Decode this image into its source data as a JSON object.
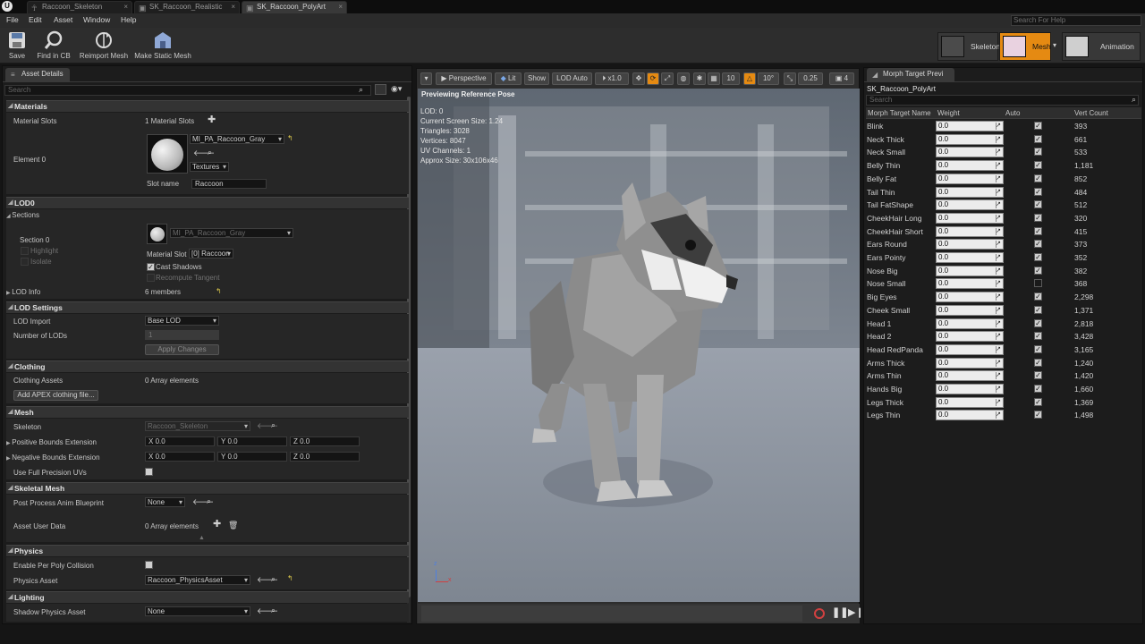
{
  "tabs": [
    "Raccoon_Skeleton",
    "SK_Raccoon_Realistic",
    "SK_Raccoon_PolyArt"
  ],
  "menu": [
    "File",
    "Edit",
    "Asset",
    "Window",
    "Help"
  ],
  "help_search": "Search For Help",
  "toolbar": {
    "save": "Save",
    "find_in_cb": "Find in CB",
    "reimport": "Reimport Mesh",
    "make_static": "Make Static Mesh"
  },
  "modes": {
    "skeleton": "Skeleton",
    "mesh": "Mesh",
    "animation": "Animation"
  },
  "details": {
    "tab": "Asset Details",
    "search_placeholder": "Search",
    "materials": {
      "header": "Materials",
      "material_slots_label": "Material Slots",
      "material_slots_value": "1 Material Slots",
      "element_label": "Element 0",
      "material_name": "MI_PA_Raccoon_Gray",
      "textures": "Textures",
      "slot_name_label": "Slot name",
      "slot_name_value": "Raccoon"
    },
    "lod0": {
      "header": "LOD0",
      "sections_label": "Sections",
      "section_label": "Section 0",
      "highlight": "Highlight",
      "isolate": "Isolate",
      "material_name": "MI_PA_Raccoon_Gray",
      "material_slot_label": "Material Slot",
      "material_slot_value": "[0] Raccoon",
      "cast_shadows": "Cast Shadows",
      "recompute_tangent": "Recompute Tangent",
      "lod_info_label": "LOD Info",
      "lod_info_value": "6 members"
    },
    "lod_settings": {
      "header": "LOD Settings",
      "lod_import_label": "LOD Import",
      "lod_import_value": "Base LOD",
      "num_lods_label": "Number of LODs",
      "num_lods_value": "1",
      "apply_changes": "Apply Changes"
    },
    "clothing": {
      "header": "Clothing",
      "assets_label": "Clothing Assets",
      "assets_value": "0 Array elements",
      "add_button": "Add APEX clothing file..."
    },
    "mesh": {
      "header": "Mesh",
      "skeleton_label": "Skeleton",
      "skeleton_value": "Raccoon_Skeleton",
      "pos_bounds_label": "Positive Bounds Extension",
      "neg_bounds_label": "Negative Bounds Extension",
      "axis_x": "X",
      "axis_y": "Y",
      "axis_z": "Z",
      "bounds_value": "0.0",
      "full_precision_label": "Use Full Precision UVs"
    },
    "skeletal_mesh": {
      "header": "Skeletal Mesh",
      "post_process_label": "Post Process Anim Blueprint",
      "post_process_value": "None",
      "asset_user_data_label": "Asset User Data",
      "asset_user_data_value": "0 Array elements"
    },
    "physics": {
      "header": "Physics",
      "per_poly_label": "Enable Per Poly Collision",
      "physics_asset_label": "Physics Asset",
      "physics_asset_value": "Raccoon_PhysicsAsset"
    },
    "lighting": {
      "header": "Lighting",
      "shadow_physics_label": "Shadow Physics Asset",
      "shadow_physics_value": "None"
    }
  },
  "viewport": {
    "perspective": "Perspective",
    "lit": "Lit",
    "show": "Show",
    "lod": "LOD Auto",
    "speed": "x1.0",
    "grid": "10",
    "angle": "10°",
    "scale": "0.25",
    "cam": "4",
    "preview_label": "Previewing Reference Pose",
    "stats": [
      "LOD: 0",
      "Current Screen Size: 1.24",
      "Triangles: 3028",
      "Vertices: 8047",
      "UV Channels: 1",
      "Approx Size: 30x106x46"
    ],
    "axis_x": "x",
    "axis_z": "z",
    "colors": {
      "sky": "#6d7580",
      "floor": "#8f96a1",
      "accent": "#e58a12"
    }
  },
  "morph": {
    "tab": "Morph Target Previ",
    "mesh_name": "SK_Raccoon_PolyArt",
    "search_placeholder": "Search",
    "columns": {
      "name": "Morph Target Name",
      "weight": "Weight",
      "auto": "Auto",
      "vert": "Vert Count"
    },
    "rows": [
      {
        "name": "Blink",
        "weight": "0.0",
        "auto": true,
        "vert": "393"
      },
      {
        "name": "Neck Thick",
        "weight": "0.0",
        "auto": true,
        "vert": "661"
      },
      {
        "name": "Neck Small",
        "weight": "0.0",
        "auto": true,
        "vert": "533"
      },
      {
        "name": "Belly Thin",
        "weight": "0.0",
        "auto": true,
        "vert": "1,181"
      },
      {
        "name": "Belly Fat",
        "weight": "0.0",
        "auto": true,
        "vert": "852"
      },
      {
        "name": "Tail Thin",
        "weight": "0.0",
        "auto": true,
        "vert": "484"
      },
      {
        "name": "Tail FatShape",
        "weight": "0.0",
        "auto": true,
        "vert": "512"
      },
      {
        "name": "CheekHair Long",
        "weight": "0.0",
        "auto": true,
        "vert": "320"
      },
      {
        "name": "CheekHair Short",
        "weight": "0.0",
        "auto": true,
        "vert": "415"
      },
      {
        "name": "Ears Round",
        "weight": "0.0",
        "auto": true,
        "vert": "373"
      },
      {
        "name": "Ears Pointy",
        "weight": "0.0",
        "auto": true,
        "vert": "352"
      },
      {
        "name": "Nose Big",
        "weight": "0.0",
        "auto": true,
        "vert": "382"
      },
      {
        "name": "Nose Small",
        "weight": "0.0",
        "auto": false,
        "vert": "368"
      },
      {
        "name": "Big Eyes",
        "weight": "0.0",
        "auto": true,
        "vert": "2,298"
      },
      {
        "name": "Cheek Small",
        "weight": "0.0",
        "auto": true,
        "vert": "1,371"
      },
      {
        "name": "Head 1",
        "weight": "0.0",
        "auto": true,
        "vert": "2,818"
      },
      {
        "name": "Head 2",
        "weight": "0.0",
        "auto": true,
        "vert": "3,428"
      },
      {
        "name": "Head RedPanda",
        "weight": "0.0",
        "auto": true,
        "vert": "3,165"
      },
      {
        "name": "Arms Thick",
        "weight": "0.0",
        "auto": true,
        "vert": "1,240"
      },
      {
        "name": "Arms Thin",
        "weight": "0.0",
        "auto": true,
        "vert": "1,420"
      },
      {
        "name": "Hands Big",
        "weight": "0.0",
        "auto": true,
        "vert": "1,660"
      },
      {
        "name": "Legs Thick",
        "weight": "0.0",
        "auto": true,
        "vert": "1,369"
      },
      {
        "name": "Legs Thin",
        "weight": "0.0",
        "auto": true,
        "vert": "1,498"
      }
    ]
  }
}
